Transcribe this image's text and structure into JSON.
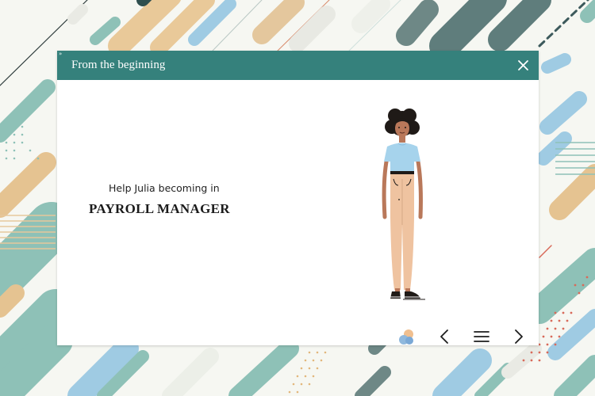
{
  "window": {
    "title": "From the beginning",
    "corner_glyph": "»",
    "close_icon": "close-icon"
  },
  "content": {
    "intro": "Help Julia becoming in",
    "headline": "PAYROLL MANAGER",
    "character_name": "Julia"
  },
  "nav": {
    "avatar_icon": "character-avatar-icon",
    "prev_icon": "chevron-left-icon",
    "menu_icon": "hamburger-menu-icon",
    "next_icon": "chevron-right-icon"
  },
  "colors": {
    "titlebar": "#35817c",
    "background": "#f6f7f2",
    "accent_teal": "#8ec1b7",
    "accent_blue": "#9fcbe3",
    "accent_sand": "#e8c89a",
    "accent_slate": "#5f7d7c",
    "accent_dots": "#d86a5a"
  }
}
